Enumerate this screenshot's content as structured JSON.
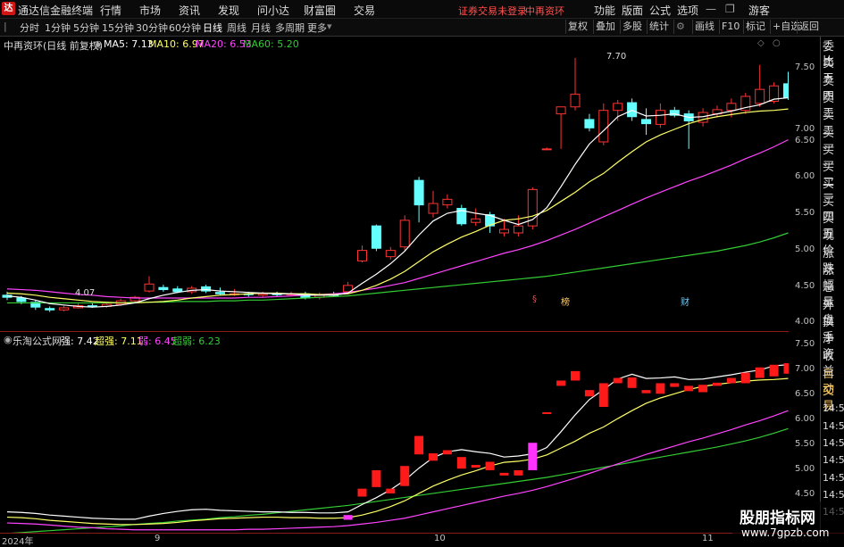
{
  "titlebar": {
    "app_name": "通达信金融终端",
    "menus": [
      "行情",
      "市场",
      "资讯",
      "发现",
      "问小达",
      "财富圈",
      "交易"
    ],
    "warning": "证券交易未登录",
    "stock_name": "中再资环",
    "right_menus": [
      "功能",
      "版面",
      "公式",
      "选项"
    ],
    "guest": "游客"
  },
  "periodbar": {
    "periods": [
      "分时",
      "1分钟",
      "5分钟",
      "15分钟",
      "30分钟",
      "60分钟",
      "日线",
      "周线",
      "月线",
      "多周期",
      "更多"
    ],
    "active": "日线",
    "buttons": [
      "复权",
      "叠加",
      "多股",
      "统计",
      "画线",
      "F10",
      "标记",
      "+自选",
      "返回"
    ]
  },
  "main_chart": {
    "title": "中再资环(日线 前复权)",
    "ma5": "MA5: 7.13",
    "ma10": "MA10: 6.97",
    "ma20": "MA20: 6.53",
    "ma60": "MA60: 5.20",
    "high_label": "7.70",
    "low_label": "4.07",
    "y_ticks": [
      "7.50",
      "7.00",
      "6.50",
      "6.00",
      "5.50",
      "5.00",
      "4.50",
      "4.00"
    ],
    "markers": [
      "§",
      "榜",
      "财"
    ],
    "colors": {
      "ma5": "#ffffff",
      "ma10": "#ffff66",
      "ma20": "#ff44ff",
      "ma60": "#33cc33",
      "up": "#ff3333",
      "down": "#66ffff"
    }
  },
  "sub_chart": {
    "title": "乐淘公式网",
    "strong": "强: 7.42",
    "super_strong": "超强: 7.11",
    "weak": "弱: 6.45",
    "super_weak": "超弱: 6.23",
    "y_ticks": [
      "7.50",
      "7.00",
      "6.50",
      "6.00",
      "5.50",
      "5.00",
      "4.50"
    ]
  },
  "right_panel": {
    "items": [
      "委比",
      "卖五",
      "卖四",
      "卖三",
      "卖二",
      "卖一",
      "买一",
      "买二",
      "买三",
      "买四",
      "买五",
      "现价",
      "涨跌",
      "涨幅",
      "总量",
      "外盘",
      "换手",
      "净资",
      "收益",
      "自动",
      "交易",
      "14:56",
      "14:56",
      "14:56",
      "14:56",
      "14:56",
      "14:56",
      "14:56"
    ]
  },
  "date_axis": {
    "labels": [
      "2024年",
      "9",
      "10",
      "11"
    ]
  },
  "watermark": {
    "title": "股朋指标网",
    "url": "www.7gpzb.com"
  },
  "chart_data": {
    "type": "candlestick",
    "title": "中再资环(日线 前复权)",
    "ylim": [
      3.9,
      7.8
    ],
    "candles": [
      {
        "o": 4.31,
        "c": 4.28,
        "h": 4.36,
        "l": 4.24
      },
      {
        "o": 4.27,
        "c": 4.22,
        "h": 4.3,
        "l": 4.18
      },
      {
        "o": 4.21,
        "c": 4.14,
        "h": 4.24,
        "l": 4.1
      },
      {
        "o": 4.12,
        "c": 4.1,
        "h": 4.15,
        "l": 4.07
      },
      {
        "o": 4.1,
        "c": 4.13,
        "h": 4.16,
        "l": 4.08
      },
      {
        "o": 4.13,
        "c": 4.16,
        "h": 4.19,
        "l": 4.12
      },
      {
        "o": 4.16,
        "c": 4.15,
        "h": 4.2,
        "l": 4.13
      },
      {
        "o": 4.15,
        "c": 4.18,
        "h": 4.2,
        "l": 4.13
      },
      {
        "o": 4.18,
        "c": 4.23,
        "h": 4.26,
        "l": 4.16
      },
      {
        "o": 4.23,
        "c": 4.28,
        "h": 4.3,
        "l": 4.2
      },
      {
        "o": 4.37,
        "c": 4.47,
        "h": 4.58,
        "l": 4.35
      },
      {
        "o": 4.42,
        "c": 4.39,
        "h": 4.46,
        "l": 4.36
      },
      {
        "o": 4.4,
        "c": 4.36,
        "h": 4.44,
        "l": 4.34
      },
      {
        "o": 4.36,
        "c": 4.41,
        "h": 4.44,
        "l": 4.33
      },
      {
        "o": 4.43,
        "c": 4.37,
        "h": 4.46,
        "l": 4.34
      },
      {
        "o": 4.35,
        "c": 4.33,
        "h": 4.42,
        "l": 4.31
      },
      {
        "o": 4.33,
        "c": 4.33,
        "h": 4.4,
        "l": 4.3
      },
      {
        "o": 4.33,
        "c": 4.32,
        "h": 4.36,
        "l": 4.29
      },
      {
        "o": 4.31,
        "c": 4.33,
        "h": 4.36,
        "l": 4.29
      },
      {
        "o": 4.33,
        "c": 4.32,
        "h": 4.36,
        "l": 4.29
      },
      {
        "o": 4.32,
        "c": 4.33,
        "h": 4.36,
        "l": 4.3
      },
      {
        "o": 4.33,
        "c": 4.27,
        "h": 4.36,
        "l": 4.25
      },
      {
        "o": 4.28,
        "c": 4.32,
        "h": 4.35,
        "l": 4.25
      },
      {
        "o": 4.32,
        "c": 4.31,
        "h": 4.36,
        "l": 4.29
      },
      {
        "o": 4.36,
        "c": 4.45,
        "h": 4.5,
        "l": 4.33
      },
      {
        "o": 4.8,
        "c": 4.95,
        "h": 5.02,
        "l": 4.78
      },
      {
        "o": 5.3,
        "c": 4.98,
        "h": 5.32,
        "l": 4.94
      },
      {
        "o": 4.86,
        "c": 4.95,
        "h": 5.0,
        "l": 4.82
      },
      {
        "o": 5.0,
        "c": 5.38,
        "h": 5.45,
        "l": 4.95
      },
      {
        "o": 5.95,
        "c": 5.6,
        "h": 6.0,
        "l": 5.35
      },
      {
        "o": 5.48,
        "c": 5.62,
        "h": 5.8,
        "l": 5.42
      },
      {
        "o": 5.6,
        "c": 5.68,
        "h": 5.75,
        "l": 5.55
      },
      {
        "o": 5.55,
        "c": 5.33,
        "h": 5.6,
        "l": 5.3
      },
      {
        "o": 5.35,
        "c": 5.4,
        "h": 5.55,
        "l": 5.3
      },
      {
        "o": 5.46,
        "c": 5.3,
        "h": 5.5,
        "l": 5.2
      },
      {
        "o": 5.2,
        "c": 5.25,
        "h": 5.4,
        "l": 5.15
      },
      {
        "o": 5.2,
        "c": 5.3,
        "h": 5.45,
        "l": 5.15
      },
      {
        "o": 5.3,
        "c": 5.82,
        "h": 5.85,
        "l": 5.25
      },
      {
        "o": 6.4,
        "c": 6.4,
        "h": 6.42,
        "l": 6.38
      },
      {
        "o": 6.9,
        "c": 7.0,
        "h": 7.0,
        "l": 6.4
      },
      {
        "o": 7.0,
        "c": 7.18,
        "h": 7.7,
        "l": 6.95
      },
      {
        "o": 6.82,
        "c": 6.7,
        "h": 6.9,
        "l": 6.65
      },
      {
        "o": 6.5,
        "c": 6.95,
        "h": 7.05,
        "l": 6.45
      },
      {
        "o": 6.95,
        "c": 7.05,
        "h": 7.1,
        "l": 6.8
      },
      {
        "o": 7.06,
        "c": 6.86,
        "h": 7.12,
        "l": 6.8
      },
      {
        "o": 6.82,
        "c": 6.76,
        "h": 6.98,
        "l": 6.6
      },
      {
        "o": 6.75,
        "c": 6.95,
        "h": 7.05,
        "l": 6.7
      },
      {
        "o": 6.95,
        "c": 6.88,
        "h": 7.0,
        "l": 6.85
      },
      {
        "o": 6.9,
        "c": 6.8,
        "h": 6.95,
        "l": 6.4
      },
      {
        "o": 6.78,
        "c": 6.92,
        "h": 6.98,
        "l": 6.72
      },
      {
        "o": 6.9,
        "c": 6.96,
        "h": 7.02,
        "l": 6.85
      },
      {
        "o": 6.95,
        "c": 7.05,
        "h": 7.12,
        "l": 6.85
      },
      {
        "o": 6.95,
        "c": 7.15,
        "h": 7.2,
        "l": 6.9
      },
      {
        "o": 7.05,
        "c": 7.25,
        "h": 7.6,
        "l": 7.0
      },
      {
        "o": 7.08,
        "c": 7.3,
        "h": 7.35,
        "l": 7.05
      },
      {
        "o": 7.33,
        "c": 7.13,
        "h": 7.5,
        "l": 7.1
      }
    ],
    "ma5": [
      4.3,
      4.28,
      4.24,
      4.19,
      4.17,
      4.15,
      4.14,
      4.15,
      4.17,
      4.2,
      4.26,
      4.31,
      4.35,
      4.38,
      4.39,
      4.37,
      4.36,
      4.35,
      4.34,
      4.33,
      4.33,
      4.31,
      4.31,
      4.31,
      4.34,
      4.48,
      4.61,
      4.76,
      4.94,
      5.17,
      5.37,
      5.48,
      5.52,
      5.48,
      5.45,
      5.38,
      5.32,
      5.39,
      5.56,
      5.86,
      6.18,
      6.47,
      6.66,
      6.86,
      6.95,
      6.87,
      6.88,
      6.9,
      6.85,
      6.86,
      6.9,
      6.94,
      6.99,
      7.03,
      7.11,
      7.13
    ],
    "ma10": [
      4.34,
      4.33,
      4.31,
      4.28,
      4.26,
      4.24,
      4.22,
      4.21,
      4.2,
      4.2,
      4.21,
      4.22,
      4.24,
      4.27,
      4.29,
      4.31,
      4.32,
      4.33,
      4.34,
      4.34,
      4.33,
      4.33,
      4.32,
      4.32,
      4.33,
      4.38,
      4.45,
      4.54,
      4.65,
      4.79,
      4.93,
      5.04,
      5.14,
      5.22,
      5.31,
      5.38,
      5.4,
      5.44,
      5.52,
      5.65,
      5.78,
      5.93,
      6.05,
      6.21,
      6.36,
      6.5,
      6.6,
      6.68,
      6.76,
      6.82,
      6.86,
      6.89,
      6.92,
      6.94,
      6.95,
      6.97
    ],
    "ma20": [
      4.4,
      4.39,
      4.38,
      4.36,
      4.34,
      4.32,
      4.31,
      4.29,
      4.28,
      4.27,
      4.27,
      4.27,
      4.27,
      4.27,
      4.27,
      4.27,
      4.27,
      4.28,
      4.28,
      4.29,
      4.3,
      4.31,
      4.32,
      4.33,
      4.35,
      4.38,
      4.41,
      4.45,
      4.49,
      4.55,
      4.61,
      4.67,
      4.73,
      4.79,
      4.85,
      4.91,
      4.96,
      5.02,
      5.09,
      5.17,
      5.25,
      5.34,
      5.43,
      5.52,
      5.61,
      5.7,
      5.78,
      5.86,
      5.94,
      6.01,
      6.09,
      6.17,
      6.26,
      6.34,
      6.43,
      6.53
    ],
    "ma60": [
      4.2,
      4.2,
      4.2,
      4.2,
      4.2,
      4.2,
      4.2,
      4.2,
      4.2,
      4.21,
      4.21,
      4.21,
      4.22,
      4.22,
      4.22,
      4.23,
      4.23,
      4.24,
      4.24,
      4.25,
      4.26,
      4.27,
      4.28,
      4.29,
      4.3,
      4.32,
      4.34,
      4.36,
      4.38,
      4.4,
      4.42,
      4.44,
      4.46,
      4.48,
      4.5,
      4.52,
      4.54,
      4.56,
      4.58,
      4.61,
      4.64,
      4.67,
      4.7,
      4.73,
      4.76,
      4.79,
      4.82,
      4.85,
      4.88,
      4.91,
      4.94,
      4.98,
      5.02,
      5.07,
      5.13,
      5.2
    ]
  }
}
